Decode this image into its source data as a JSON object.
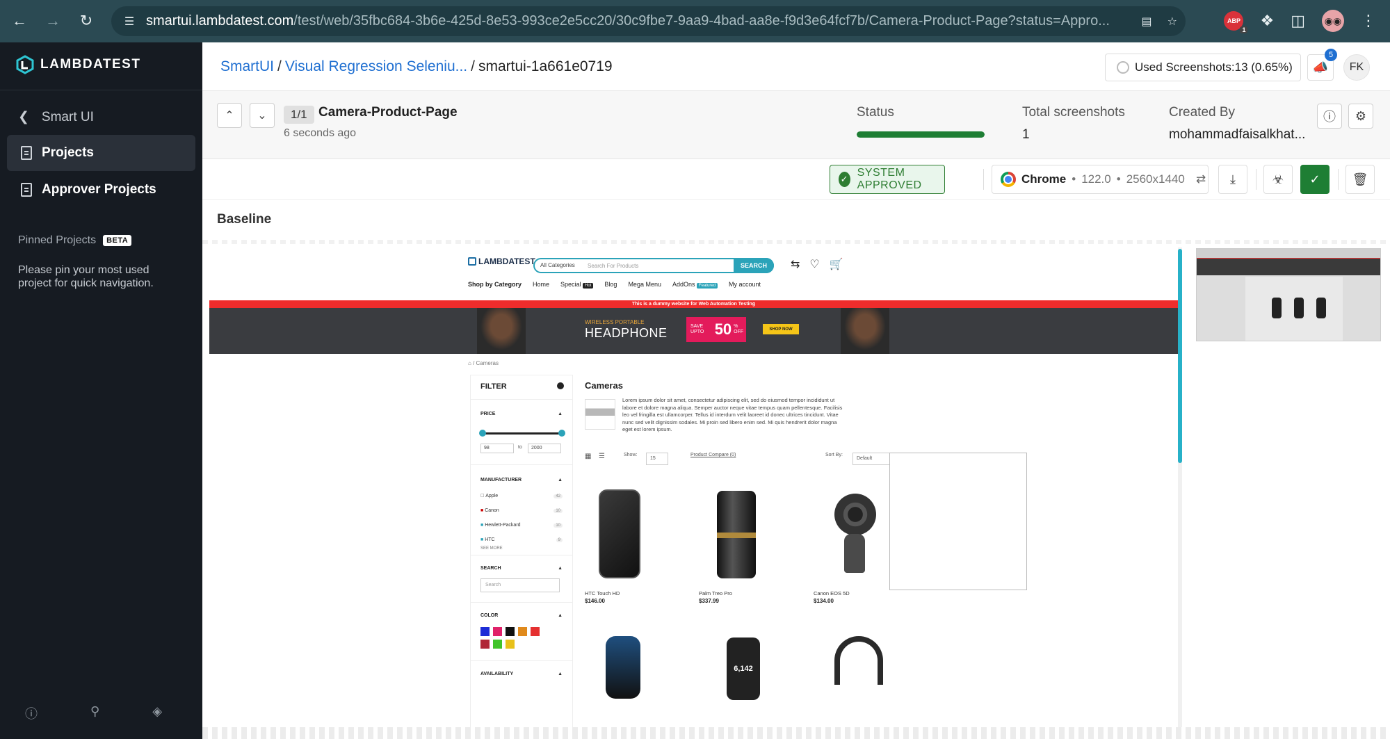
{
  "browser": {
    "url_domain": "smartui.lambdatest.com",
    "url_path": "/test/web/35fbc684-3b6e-425d-8e53-993ce2e5cc20/30c9fbe7-9aa9-4bad-aa8e-f9d3e64fcf7b/Camera-Product-Page?status=Appro...",
    "ext_badge": "1",
    "ext_label": "ABP"
  },
  "sidebar": {
    "logo": "LAMBDATEST",
    "back_label": "Smart UI",
    "items": [
      {
        "label": "Projects",
        "active": true
      },
      {
        "label": "Approver Projects",
        "active": false
      }
    ],
    "pinned_title": "Pinned Projects",
    "beta": "BETA",
    "pinned_msg": "Please pin your most used project for quick navigation."
  },
  "header": {
    "crumb1": "SmartUI",
    "crumb2": "Visual Regression Seleniu...",
    "crumb3": "smartui-1a661e0719",
    "sep": "/",
    "usage": "Used Screenshots:13 (0.65%)",
    "notif_count": "5",
    "user_initials": "FK"
  },
  "screenshot": {
    "counter": "1/1",
    "name": "Camera-Product-Page",
    "time": "6 seconds ago",
    "status_label": "Status",
    "status_progress": 1.0,
    "total_label": "Total screenshots",
    "total_value": "1",
    "created_label": "Created By",
    "created_value": "mohammadfaisalkhat..."
  },
  "toolbar": {
    "approved_label": "SYSTEM APPROVED",
    "browser_name": "Chrome",
    "dot": "•",
    "browser_version": "122.0",
    "resolution": "2560x1440"
  },
  "baseline_label": "Baseline",
  "webpage": {
    "logo": "LAMBDATEST",
    "category": "All Categories",
    "search_placeholder": "Search For Products",
    "search_btn": "SEARCH",
    "nav": [
      "Shop by Category",
      "Home",
      "Special",
      "Blog",
      "Mega Menu",
      "AddOns",
      "My account"
    ],
    "hot": "Hot",
    "featured": "Featured",
    "banner_notice": "This is a dummy website for Web Automation Testing",
    "banner_small": "WIRELESS PORTABLE",
    "banner_big": "HEADPHONE",
    "save_upto": "SAVE UPTO",
    "save_pct": "50",
    "save_off": "% OFF",
    "shop_now": "SHOP NOW",
    "crumb": "/   Cameras",
    "filter_title": "FILTER",
    "price_label": "PRICE",
    "price_min": "98",
    "price_to": "to",
    "price_max": "2000",
    "manufacturer_label": "MANUFACTURER",
    "manufacturers": [
      {
        "name": "Apple",
        "count": "42"
      },
      {
        "name": "Canon",
        "count": "10"
      },
      {
        "name": "Hewlett-Packard",
        "count": "10"
      },
      {
        "name": "HTC",
        "count": "9"
      }
    ],
    "see_more": "SEE MORE",
    "search_label": "SEARCH",
    "search_box": "Search",
    "color_label": "COLOR",
    "colors": [
      "#1d2cd6",
      "#e0226a",
      "#111111",
      "#e08a1c",
      "#e53030",
      "#b02636",
      "#40c42a",
      "#e8c11a"
    ],
    "availability_label": "AVAILABILITY",
    "category_title": "Cameras",
    "description": "Lorem ipsum dolor sit amet, consectetur adipiscing elit, sed do eiusmod tempor incididunt ut labore et dolore magna aliqua. Semper auctor neque vitae tempus quam pellentesque. Facilisis leo vel fringilla est ullamcorper. Tellus id interdum velit laoreet id donec ultrices tincidunt. Vitae nunc sed velit dignissim sodales. Mi proin sed libero enim sed. Mi quis hendrerit dolor magna eget est lorem ipsum.",
    "show_label": "Show:",
    "show_value": "15",
    "compare": "Product Compare (0)",
    "sort_label": "Sort By:",
    "sort_value": "Default",
    "products": [
      {
        "name": "HTC Touch HD",
        "price": "$146.00"
      },
      {
        "name": "Palm Treo Pro",
        "price": "$337.99"
      },
      {
        "name": "Canon EOS 5D",
        "price": "$134.00"
      }
    ],
    "watch_steps": "6,142"
  }
}
